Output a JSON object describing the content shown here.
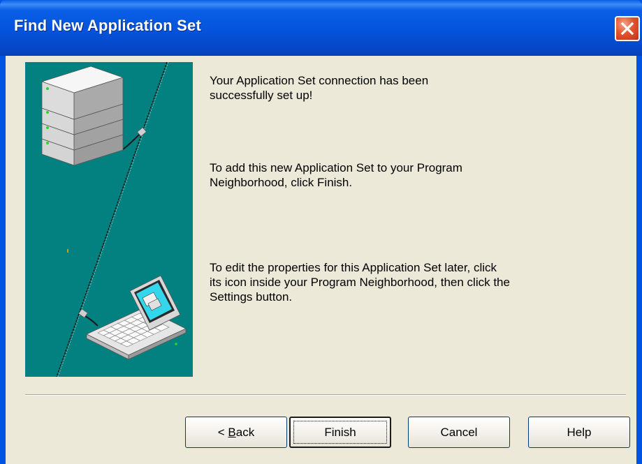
{
  "window": {
    "title": "Find New Application Set"
  },
  "messages": {
    "line1": "Your Application Set connection has been",
    "line2": "successfully set up!",
    "line3": "To add this new Application Set to your Program",
    "line4": "Neighborhood, click Finish.",
    "line5": "To edit the properties for this Application Set later, click",
    "line6": "its icon inside your Program Neighborhood, then click the",
    "line7": "Settings button."
  },
  "buttons": {
    "back_prefix": "< ",
    "back_mnemonic": "B",
    "back_rest": "ack",
    "finish": "Finish",
    "cancel": "Cancel",
    "help": "Help"
  },
  "colors": {
    "titlebar": "#0054e3",
    "dialog_bg": "#ece9d8",
    "illustration_bg": "#038181",
    "close_button": "#e2552f"
  },
  "icons": {
    "close": "close-icon",
    "server": "server-stack-icon",
    "laptop": "laptop-icon"
  }
}
